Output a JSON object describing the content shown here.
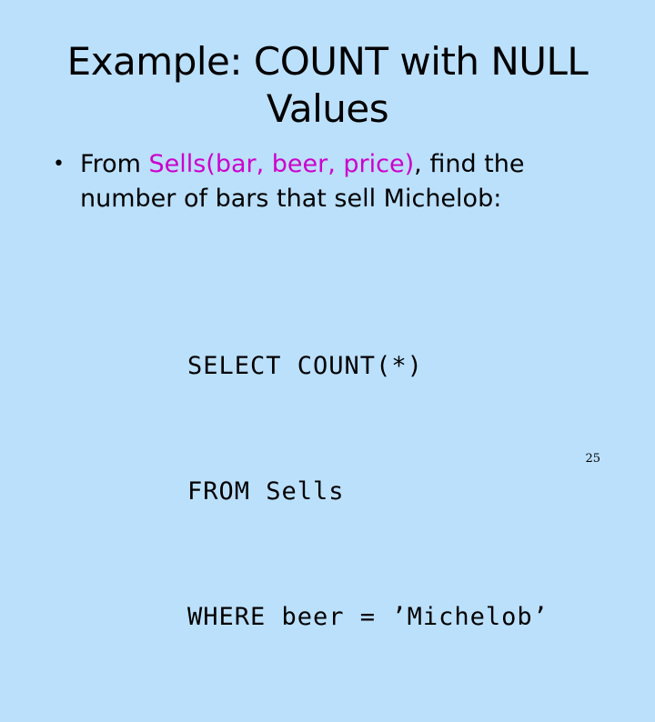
{
  "slide": {
    "title_line1": "Example: COUNT with NULL",
    "title_line2": "Values",
    "bullet": {
      "marker": "•",
      "pre": "From ",
      "highlight": "Sells(bar, beer, price)",
      "post_line1": ", find the",
      "line2": "number of bars that sell Michelob:"
    },
    "code": [
      "SELECT COUNT(*)",
      "FROM Sells",
      "WHERE beer = ’Michelob’"
    ],
    "page_number": "25"
  },
  "colors": {
    "background": "#bbe0fc",
    "highlight": "#cc00cc",
    "text": "#000000"
  }
}
